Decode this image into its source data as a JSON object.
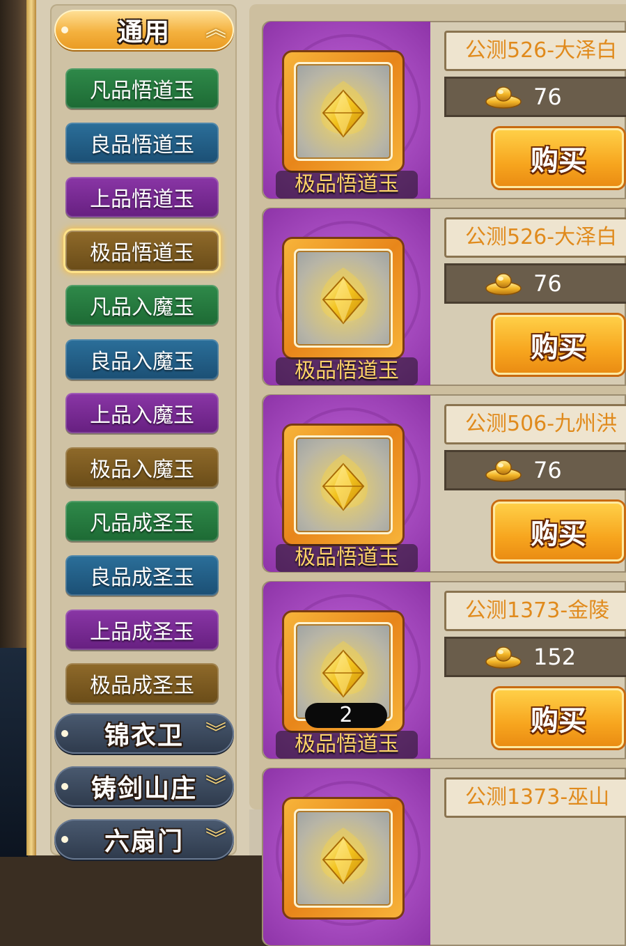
{
  "categories": {
    "general": {
      "title": "通用",
      "expanded": true
    },
    "jinyiwei": {
      "title": "锦衣卫",
      "expanded": false
    },
    "zhujianshanzhuang": {
      "title": "铸剑山庄",
      "expanded": false
    },
    "liushanmen": {
      "title": "六扇门",
      "expanded": false
    }
  },
  "sub_items": [
    {
      "label": "凡品悟道玉",
      "color": "green"
    },
    {
      "label": "良品悟道玉",
      "color": "blue"
    },
    {
      "label": "上品悟道玉",
      "color": "purple"
    },
    {
      "label": "极品悟道玉",
      "color": "brown",
      "selected": true
    },
    {
      "label": "凡品入魔玉",
      "color": "green"
    },
    {
      "label": "良品入魔玉",
      "color": "blue"
    },
    {
      "label": "上品入魔玉",
      "color": "purple"
    },
    {
      "label": "极品入魔玉",
      "color": "brown"
    },
    {
      "label": "凡品成圣玉",
      "color": "green"
    },
    {
      "label": "良品成圣玉",
      "color": "blue"
    },
    {
      "label": "上品成圣玉",
      "color": "purple"
    },
    {
      "label": "极品成圣玉",
      "color": "brown"
    }
  ],
  "listings": [
    {
      "item_name": "极品悟道玉",
      "seller": "公测526-大泽白",
      "price": "76",
      "buy_label": "购买",
      "quantity": ""
    },
    {
      "item_name": "极品悟道玉",
      "seller": "公测526-大泽白",
      "price": "76",
      "buy_label": "购买",
      "quantity": ""
    },
    {
      "item_name": "极品悟道玉",
      "seller": "公测506-九州洪",
      "price": "76",
      "buy_label": "购买",
      "quantity": ""
    },
    {
      "item_name": "极品悟道玉",
      "seller": "公测1373-金陵",
      "price": "152",
      "buy_label": "购买",
      "quantity": "2"
    },
    {
      "item_name": "",
      "seller": "公测1373-巫山",
      "price": "",
      "buy_label": "",
      "quantity": ""
    }
  ],
  "icons": {
    "expand": "chevron-up-icon",
    "collapse": "chevron-down-icon",
    "currency": "gold-ingot-icon",
    "item": "golden-jade-gem-icon"
  },
  "colors": {
    "accent_gold": "#f7a51e",
    "seller_text": "#e08a1c",
    "item_name_text": "#ffd36a"
  }
}
